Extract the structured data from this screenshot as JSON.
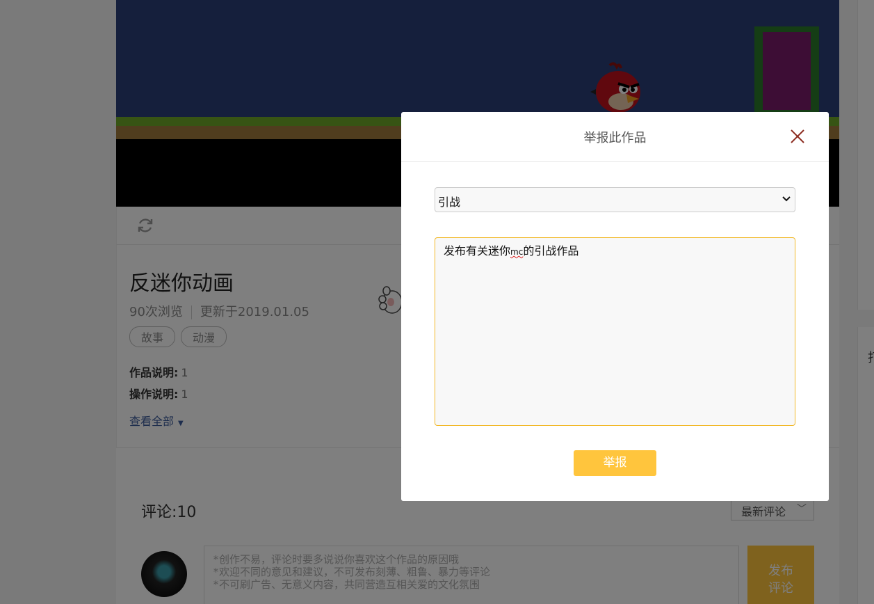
{
  "work": {
    "title": "反迷你动画",
    "views": "90次浏览",
    "updated": "更新于2019.01.05",
    "tags": [
      "故事",
      "动漫"
    ],
    "description_label": "作品说明:",
    "description_value": "1",
    "operation_label": "操作说明:",
    "operation_value": "1",
    "see_all": "查看全部"
  },
  "comments": {
    "title": "评论:10",
    "sort_value": "最新评论",
    "placeholder": "*创作不易，评论时要多说说你喜欢这个作品的原因哦\n*欢迎不同的意见和建议，不可发布刻薄、粗鲁、暴力等评论\n*不可刷广告、无意义内容，共同营造互相关爱的文化氛围",
    "publish_label": "发布\n评论"
  },
  "right_col": {
    "cut_text": "打"
  },
  "modal": {
    "title": "举报此作品",
    "reason_selected": "引战",
    "reason_text_before": "发布有关迷你",
    "reason_text_misspelled": "mc",
    "reason_text_after": "的引战作品",
    "submit_label": "举报"
  },
  "colors": {
    "accent": "#ffc53d",
    "textarea_border": "#f2b827",
    "close_icon": "#8b2a1e",
    "link": "#3a5a9a"
  },
  "icons": [
    "refresh-icon",
    "close-icon",
    "chevron-down-icon",
    "caret-down-icon",
    "angry-bird-sprite",
    "paw-icon"
  ]
}
